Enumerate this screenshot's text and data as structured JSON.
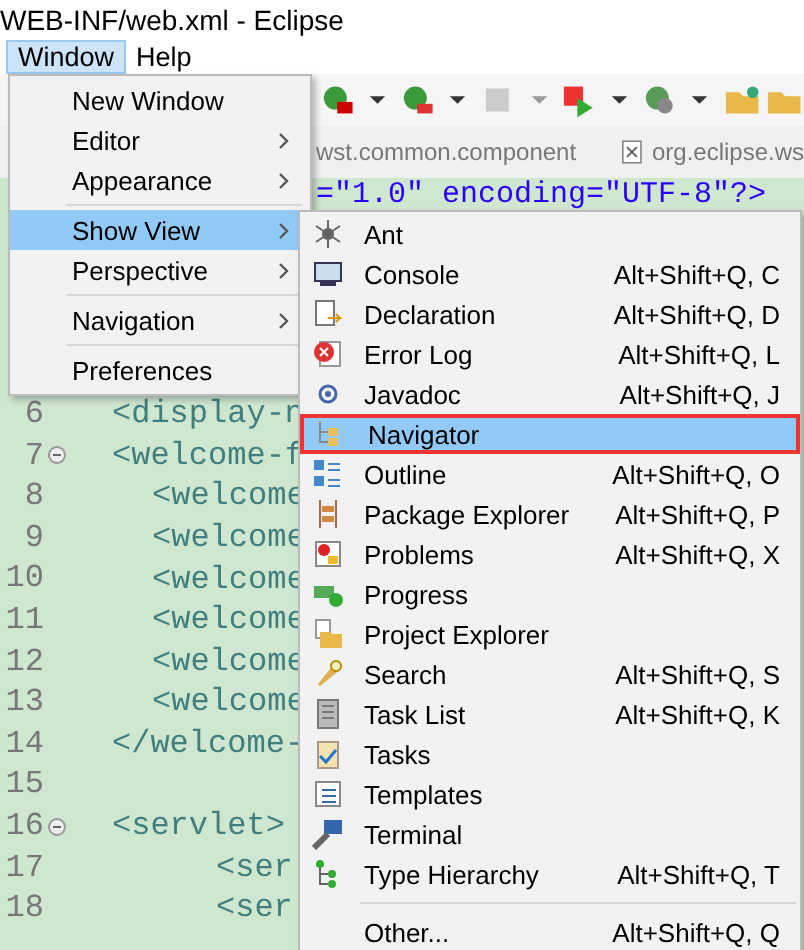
{
  "window": {
    "title": "WEB-INF/web.xml - Eclipse"
  },
  "menu_bar": [
    {
      "label": "Window",
      "selected": true
    },
    {
      "label": "Help",
      "selected": false
    }
  ],
  "editor_tabs": [
    {
      "label": "wst.common.component"
    },
    {
      "label": "org.eclipse.ws"
    }
  ],
  "editor": {
    "first_line_fragment": "=\"1.0\" encoding=\"UTF-8\"?>",
    "lines": [
      {
        "number": "6",
        "code": "<display-n",
        "fold": false
      },
      {
        "number": "7",
        "code": "<welcome-f",
        "fold": true
      },
      {
        "number": "8",
        "code": "<welcome",
        "fold": false
      },
      {
        "number": "9",
        "code": "<welcome",
        "fold": false
      },
      {
        "number": "10",
        "code": "<welcome",
        "fold": false
      },
      {
        "number": "11",
        "code": "<welcome",
        "fold": false
      },
      {
        "number": "12",
        "code": "<welcome",
        "fold": false
      },
      {
        "number": "13",
        "code": "<welcome",
        "fold": false
      },
      {
        "number": "14",
        "code": "</welcome-",
        "fold": false
      },
      {
        "number": "15",
        "fold": false
      },
      {
        "number": "16",
        "code": "<servlet>",
        "fold": true
      },
      {
        "number": "17",
        "code": "<ser",
        "fold": false
      },
      {
        "number": "18",
        "code": "<ser",
        "fold": false
      }
    ]
  },
  "window_menu": [
    {
      "label": "New Window",
      "submenu": false,
      "selected": false,
      "separator_after": false
    },
    {
      "label": "Editor",
      "submenu": true,
      "selected": false,
      "separator_after": false
    },
    {
      "label": "Appearance",
      "submenu": true,
      "selected": false,
      "separator_after": true
    },
    {
      "label": "Show View",
      "submenu": true,
      "selected": true,
      "separator_after": false
    },
    {
      "label": "Perspective",
      "submenu": true,
      "selected": false,
      "separator_after": true
    },
    {
      "label": "Navigation",
      "submenu": true,
      "selected": false,
      "separator_after": true
    },
    {
      "label": "Preferences",
      "submenu": false,
      "selected": false,
      "separator_after": false
    }
  ],
  "show_view_menu": [
    {
      "label": "Ant",
      "selected": false,
      "outlined": false,
      "separator_before": false
    },
    {
      "label": "Console",
      "shortcut": "Alt+Shift+Q, C",
      "selected": false,
      "outlined": false,
      "separator_before": false
    },
    {
      "label": "Declaration",
      "shortcut": "Alt+Shift+Q, D",
      "selected": false,
      "outlined": false,
      "separator_before": false
    },
    {
      "label": "Error Log",
      "shortcut": "Alt+Shift+Q, L",
      "selected": false,
      "outlined": false,
      "separator_before": false
    },
    {
      "label": "Javadoc",
      "shortcut": "Alt+Shift+Q, J",
      "selected": false,
      "outlined": false,
      "separator_before": false
    },
    {
      "label": "Navigator",
      "selected": true,
      "outlined": true,
      "separator_before": false
    },
    {
      "label": "Outline",
      "shortcut": "Alt+Shift+Q, O",
      "selected": false,
      "outlined": false,
      "separator_before": false
    },
    {
      "label": "Package Explorer",
      "shortcut": "Alt+Shift+Q, P",
      "selected": false,
      "outlined": false,
      "separator_before": false
    },
    {
      "label": "Problems",
      "shortcut": "Alt+Shift+Q, X",
      "selected": false,
      "outlined": false,
      "separator_before": false
    },
    {
      "label": "Progress",
      "selected": false,
      "outlined": false,
      "separator_before": false
    },
    {
      "label": "Project Explorer",
      "selected": false,
      "outlined": false,
      "separator_before": false
    },
    {
      "label": "Search",
      "shortcut": "Alt+Shift+Q, S",
      "selected": false,
      "outlined": false,
      "separator_before": false
    },
    {
      "label": "Task List",
      "shortcut": "Alt+Shift+Q, K",
      "selected": false,
      "outlined": false,
      "separator_before": false
    },
    {
      "label": "Tasks",
      "selected": false,
      "outlined": false,
      "separator_before": false
    },
    {
      "label": "Templates",
      "selected": false,
      "outlined": false,
      "separator_before": false
    },
    {
      "label": "Terminal",
      "selected": false,
      "outlined": false,
      "separator_before": false
    },
    {
      "label": "Type Hierarchy",
      "shortcut": "Alt+Shift+Q, T",
      "selected": false,
      "outlined": false,
      "separator_before": false
    },
    {
      "label": "Other...",
      "shortcut": "Alt+Shift+Q, Q",
      "selected": false,
      "outlined": false,
      "separator_before": true
    }
  ]
}
